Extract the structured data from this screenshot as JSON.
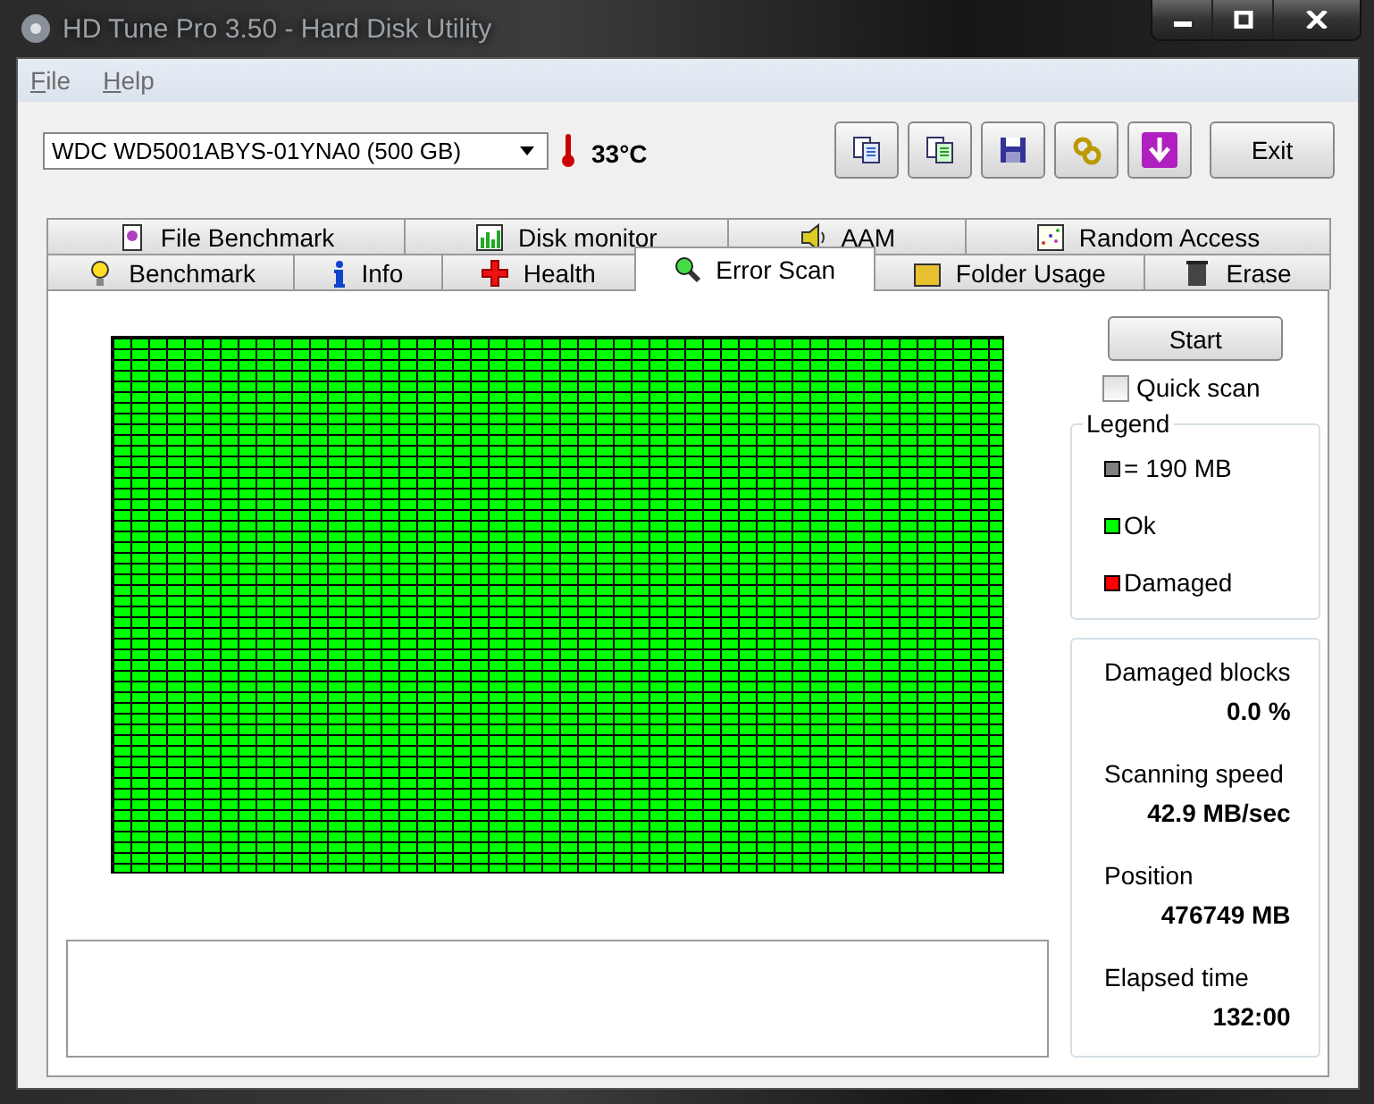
{
  "window": {
    "title": "HD Tune Pro 3.50 - Hard Disk Utility"
  },
  "menu": [
    {
      "label": "File"
    },
    {
      "label": "Help"
    }
  ],
  "drive": {
    "value": "WDC WD5001ABYS-01YNA0 (500 GB)",
    "temperature": "33°C"
  },
  "toolbar": {
    "exit": "Exit"
  },
  "tabs_top": [
    {
      "label": "File Benchmark",
      "selected": false
    },
    {
      "label": "Disk monitor",
      "selected": false
    },
    {
      "label": "AAM",
      "selected": false
    },
    {
      "label": "Random Access",
      "selected": false
    }
  ],
  "tabs_bottom": [
    {
      "label": "Benchmark",
      "selected": false
    },
    {
      "label": "Info",
      "selected": false
    },
    {
      "label": "Health",
      "selected": false
    },
    {
      "label": "Error Scan",
      "selected": true
    },
    {
      "label": "Folder Usage",
      "selected": false
    },
    {
      "label": "Erase",
      "selected": false
    }
  ],
  "start_button": "Start",
  "quick_scan": {
    "label": "Quick scan",
    "checked": false
  },
  "legend": {
    "title": "Legend",
    "items": [
      {
        "label": "= 190 MB",
        "color": "#808080"
      },
      {
        "label": "Ok",
        "color": "#00ff00"
      },
      {
        "label": "Damaged",
        "color": "#ff0000"
      }
    ]
  },
  "stats": [
    {
      "label": "Damaged blocks",
      "value": "0.0 %"
    },
    {
      "label": "Scanning speed",
      "value": "42.9 MB/sec"
    },
    {
      "label": "Position",
      "value": "476749 MB"
    },
    {
      "label": "Elapsed time",
      "value": "132:00"
    }
  ]
}
